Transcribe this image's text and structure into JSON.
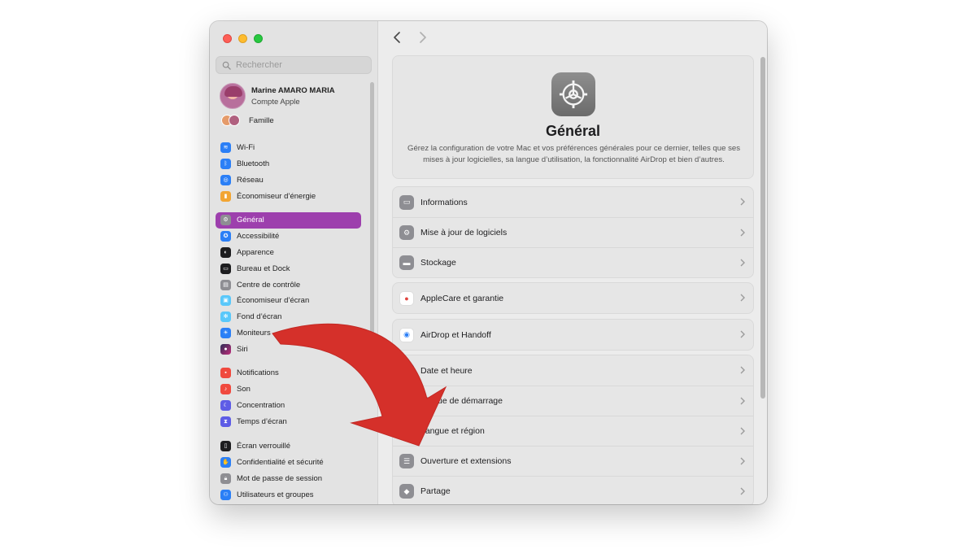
{
  "sidebar": {
    "search_placeholder": "Rechercher",
    "account": {
      "name": "Marine AMARO MARIA",
      "subtitle": "Compte Apple"
    },
    "famille": "Famille",
    "group1": [
      {
        "label": "Wi-Fi",
        "icon": "wifi-icon",
        "color": "#2b7ff6"
      },
      {
        "label": "Bluetooth",
        "icon": "bluetooth-icon",
        "color": "#2b7ff6"
      },
      {
        "label": "Réseau",
        "icon": "globe-icon",
        "color": "#2b7ff6"
      },
      {
        "label": "Économiseur d’énergie",
        "icon": "battery-icon",
        "color": "#f2a533"
      }
    ],
    "group2": [
      {
        "label": "Général",
        "icon": "gear-icon",
        "color": "#8e8e93",
        "active": true
      },
      {
        "label": "Accessibilité",
        "icon": "accessibility-icon",
        "color": "#2b7ff6"
      },
      {
        "label": "Apparence",
        "icon": "appearance-icon",
        "color": "#1d1d1f"
      },
      {
        "label": "Bureau et Dock",
        "icon": "dock-icon",
        "color": "#1d1d1f"
      },
      {
        "label": "Centre de contrôle",
        "icon": "control-center-icon",
        "color": "#8e8e93"
      },
      {
        "label": "Économiseur d’écran",
        "icon": "screensaver-icon",
        "color": "#5ac8fa"
      },
      {
        "label": "Fond d’écran",
        "icon": "wallpaper-icon",
        "color": "#5ac8fa"
      },
      {
        "label": "Moniteurs",
        "icon": "display-icon",
        "color": "#2b7ff6"
      },
      {
        "label": "Siri",
        "icon": "siri-icon",
        "color": "#3a3a3c"
      }
    ],
    "group3": [
      {
        "label": "Notifications",
        "icon": "notifications-icon",
        "color": "#f0493e"
      },
      {
        "label": "Son",
        "icon": "sound-icon",
        "color": "#f0493e"
      },
      {
        "label": "Concentration",
        "icon": "moon-icon",
        "color": "#5e5ce6"
      },
      {
        "label": "Temps d’écran",
        "icon": "hourglass-icon",
        "color": "#5e5ce6"
      }
    ],
    "group4": [
      {
        "label": "Écran verrouillé",
        "icon": "lock-screen-icon",
        "color": "#1d1d1f"
      },
      {
        "label": "Confidentialité et sécurité",
        "icon": "hand-icon",
        "color": "#2b7ff6"
      },
      {
        "label": "Mot de passe de session",
        "icon": "lock-icon",
        "color": "#8e8e93"
      },
      {
        "label": "Utilisateurs et groupes",
        "icon": "users-icon",
        "color": "#2b7ff6"
      }
    ]
  },
  "main": {
    "title": "Général",
    "description": "Gérez la configuration de votre Mac et vos préférences générales pour ce dernier, telles que ses mises à jour logicielles, sa langue d’utilisation, la fonctionnalité AirDrop et bien d’autres.",
    "card1": [
      {
        "label": "Informations",
        "icon": "info-icon",
        "color": "#8e8e93"
      },
      {
        "label": "Mise à jour de logiciels",
        "icon": "software-update-icon",
        "color": "#8e8e93"
      },
      {
        "label": "Stockage",
        "icon": "storage-icon",
        "color": "#8e8e93"
      }
    ],
    "card2": [
      {
        "label": "AppleCare et garantie",
        "icon": "apple-icon",
        "color": "#ffffff"
      }
    ],
    "card3": [
      {
        "label": "AirDrop et Handoff",
        "icon": "airdrop-icon",
        "color": "#ffffff"
      }
    ],
    "card4": [
      {
        "label": "Date et heure",
        "icon": "calendar-icon",
        "color": "#2b7ff6"
      },
      {
        "label": "Disque de démarrage",
        "icon": "disk-icon",
        "color": "#8e8e93"
      },
      {
        "label": "Langue et région",
        "icon": "language-icon",
        "color": "#2b7ff6"
      },
      {
        "label": "Ouverture et extensions",
        "icon": "list-icon",
        "color": "#8e8e93"
      },
      {
        "label": "Partage",
        "icon": "sharing-icon",
        "color": "#8e8e93"
      }
    ]
  },
  "annotation": {
    "arrow_color": "#d5302a"
  }
}
